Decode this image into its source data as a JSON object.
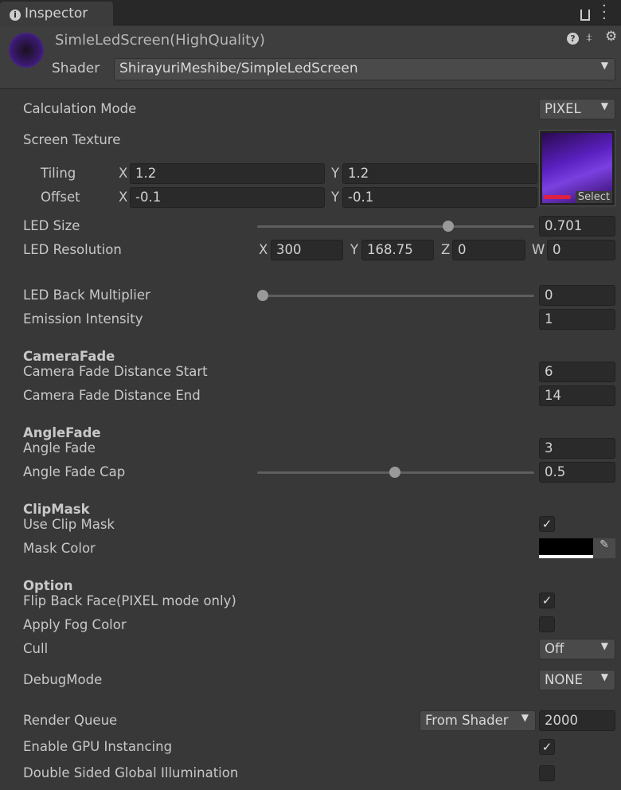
{
  "tab": {
    "title": "Inspector",
    "info_icon": "info-icon",
    "lock_icon": "lock-icon",
    "menu_icon": "kebab-menu-icon"
  },
  "material": {
    "name": "SimleLedScreen(HighQuality)",
    "shader_label": "Shader",
    "shader_value": "ShirayuriMeshibe/SimpleLedScreen"
  },
  "props": {
    "calc_mode_label": "Calculation Mode",
    "calc_mode_value": "PIXEL",
    "screen_texture_label": "Screen Texture",
    "select_label": "Select",
    "tiling_label": "Tiling",
    "tiling_x": "1.2",
    "tiling_y": "1.2",
    "offset_label": "Offset",
    "offset_x": "-0.1",
    "offset_y": "-0.1",
    "x": "X",
    "y": "Y",
    "z": "Z",
    "w": "W",
    "led_size_label": "LED Size",
    "led_size_value": "0.701",
    "led_size_fraction": 0.7,
    "led_res_label": "LED Resolution",
    "led_res_x": "300",
    "led_res_y": "168.75",
    "led_res_z": "0",
    "led_res_w": "0",
    "back_mult_label": "LED Back Multiplier",
    "back_mult_value": "0",
    "emission_label": "Emission Intensity",
    "emission_value": "1",
    "camera_fade_header": "CameraFade",
    "cam_start_label": "Camera Fade Distance Start",
    "cam_start_value": "6",
    "cam_end_label": "Camera Fade Distance End",
    "cam_end_value": "14",
    "angle_fade_header": "AngleFade",
    "angle_fade_label": "Angle Fade",
    "angle_fade_value": "3",
    "angle_cap_label": "Angle Fade Cap",
    "angle_cap_value": "0.5",
    "clip_header": "ClipMask",
    "use_clip_label": "Use Clip Mask",
    "use_clip_checked": true,
    "mask_color_label": "Mask Color",
    "mask_color": "#000000",
    "option_header": "Option",
    "flip_label": "Flip Back Face(PIXEL mode only)",
    "flip_checked": true,
    "fog_label": "Apply Fog Color",
    "fog_checked": false,
    "cull_label": "Cull",
    "cull_value": "Off",
    "debug_label": "DebugMode",
    "debug_value": "NONE",
    "rq_label": "Render Queue",
    "rq_mode": "From Shader",
    "rq_value": "2000",
    "gpu_label": "Enable GPU Instancing",
    "gpu_checked": true,
    "dsgi_label": "Double Sided Global Illumination",
    "dsgi_checked": false
  }
}
